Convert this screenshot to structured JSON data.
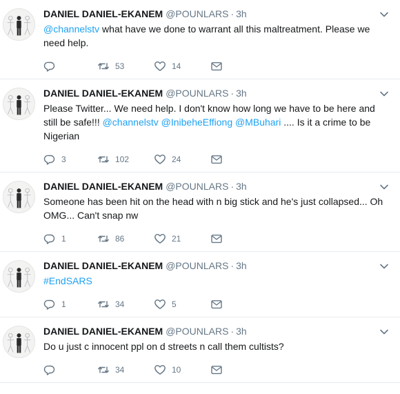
{
  "tweets": [
    {
      "name": "DANIEL DANIEL-EKANEM",
      "handle": "@POUNLARS",
      "separator": "·",
      "time": "3h",
      "segments": [
        {
          "text": "@channelstv",
          "link": true
        },
        {
          "text": " what have we done to warrant all this maltreatment. Please we need help.",
          "link": false
        }
      ],
      "replies": "",
      "retweets": "53",
      "likes": "14"
    },
    {
      "name": "DANIEL DANIEL-EKANEM",
      "handle": "@POUNLARS",
      "separator": "·",
      "time": "3h",
      "segments": [
        {
          "text": "Please Twitter... We need help. I don't know how long we have to be here and still be safe!!! ",
          "link": false
        },
        {
          "text": "@channelstv",
          "link": true
        },
        {
          "text": " ",
          "link": false
        },
        {
          "text": "@InibeheEffiong",
          "link": true
        },
        {
          "text": " ",
          "link": false
        },
        {
          "text": "@MBuhari",
          "link": true
        },
        {
          "text": " .... Is it a crime to be Nigerian",
          "link": false
        }
      ],
      "replies": "3",
      "retweets": "102",
      "likes": "24"
    },
    {
      "name": "DANIEL DANIEL-EKANEM",
      "handle": "@POUNLARS",
      "separator": "·",
      "time": "3h",
      "segments": [
        {
          "text": "Someone has been hit on the head with n big stick and he's just collapsed... Oh OMG... Can't snap nw",
          "link": false
        }
      ],
      "replies": "1",
      "retweets": "86",
      "likes": "21"
    },
    {
      "name": "DANIEL DANIEL-EKANEM",
      "handle": "@POUNLARS",
      "separator": "·",
      "time": "3h",
      "segments": [
        {
          "text": "#EndSARS",
          "link": true
        }
      ],
      "replies": "1",
      "retweets": "34",
      "likes": "5"
    },
    {
      "name": "DANIEL DANIEL-EKANEM",
      "handle": "@POUNLARS",
      "separator": "·",
      "time": "3h",
      "segments": [
        {
          "text": "Do u just c innocent ppl on d streets n call them cultists?",
          "link": false
        }
      ],
      "replies": "",
      "retweets": "34",
      "likes": "10"
    }
  ],
  "icons": {
    "reply": "reply-icon",
    "retweet": "retweet-icon",
    "like": "heart-icon",
    "message": "envelope-icon",
    "more": "chevron-down-icon"
  },
  "colors": {
    "link": "#1da1f2",
    "secondary_text": "#657786",
    "divider": "#e6ecf0"
  }
}
